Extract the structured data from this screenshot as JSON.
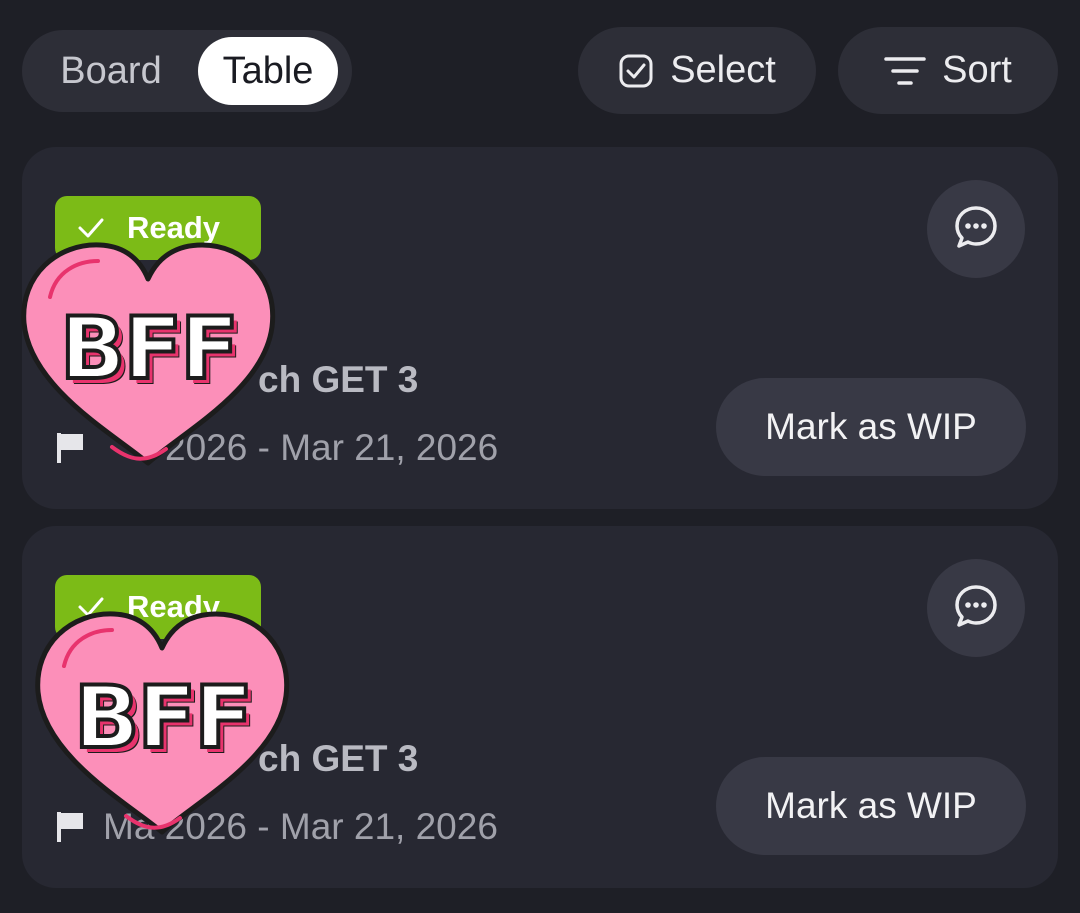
{
  "toolbar": {
    "view_options": [
      "Board",
      "Table"
    ],
    "active_view": "Table",
    "select_label": "Select",
    "sort_label": "Sort"
  },
  "tasks": [
    {
      "status": "Ready",
      "title": "ch GET 3",
      "dates": "2026 - Mar 21, 2026",
      "action_label": "Mark as WIP",
      "sticker_text": "BFF"
    },
    {
      "status": "Ready",
      "title": "ch GET 3",
      "dates": "Ma 2026 - Mar 21, 2026",
      "action_label": "Mark as WIP",
      "sticker_text": "BFF"
    }
  ],
  "colors": {
    "background": "#1e1f26",
    "card": "#272832",
    "button": "#383945",
    "status_ready": "#7cbb17",
    "sticker_pink": "#fc8fb9",
    "sticker_accent": "#e8336d"
  },
  "icons": {
    "select": "checkbox-icon",
    "sort": "sort-lines-icon",
    "status": "check-icon",
    "comment": "chat-bubble-icon",
    "date": "flag-icon"
  }
}
